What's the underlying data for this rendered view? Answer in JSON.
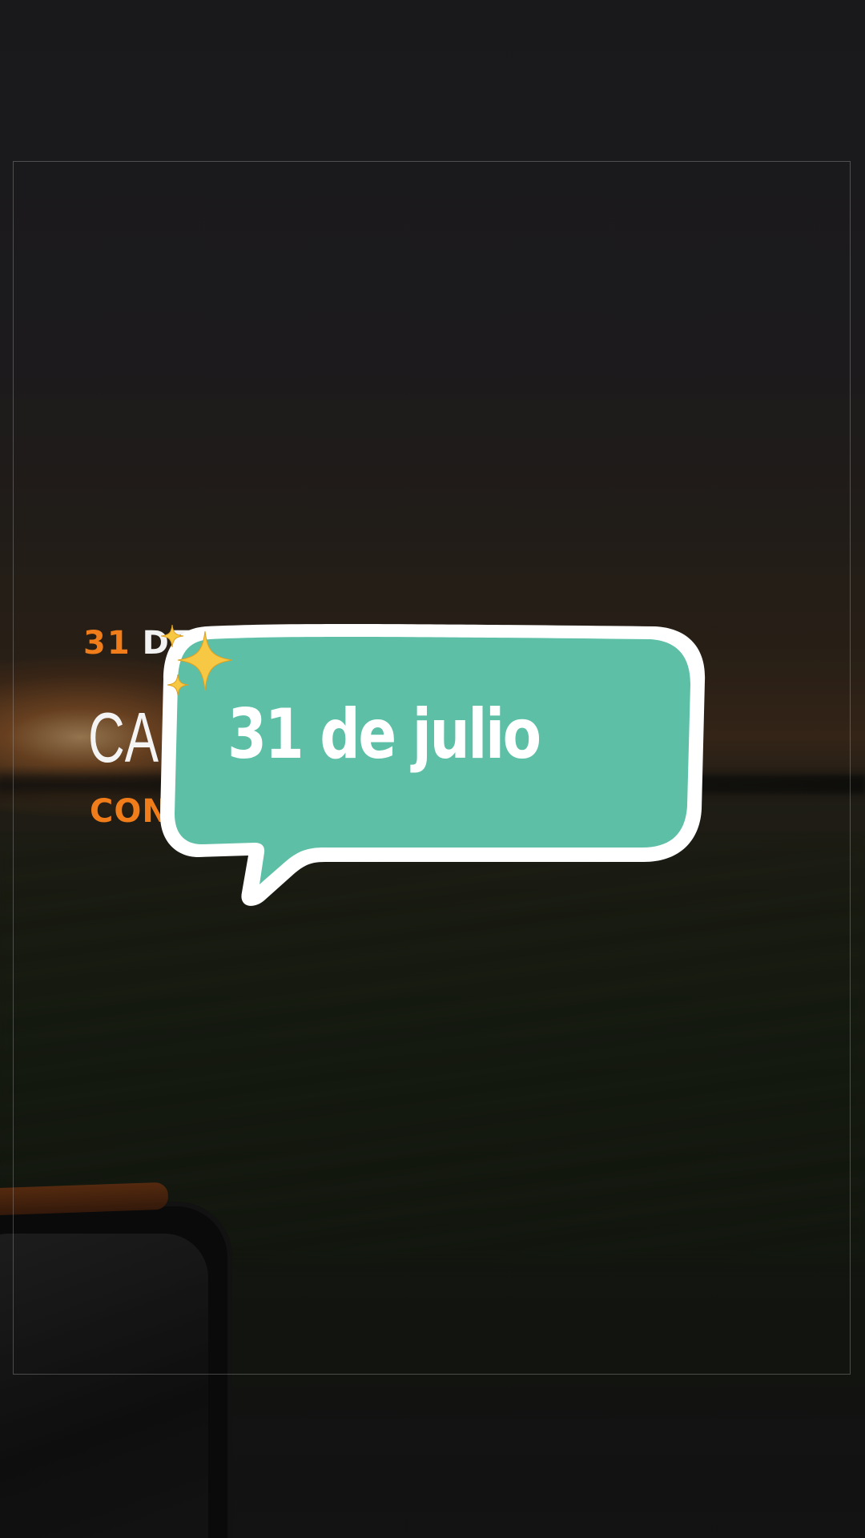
{
  "background": {
    "scene": "sunset-road-view"
  },
  "card": {
    "date_number": "31",
    "date_rest": "DE",
    "title": "CAR",
    "subtitle": "CON"
  },
  "sticker": {
    "text": "31 de julio",
    "icon": "sparkles-icon",
    "fill_color": "#5cbfa6",
    "outline_color": "#ffffff",
    "star_color": "#f7c843"
  },
  "accent_color": "#f07d1a"
}
